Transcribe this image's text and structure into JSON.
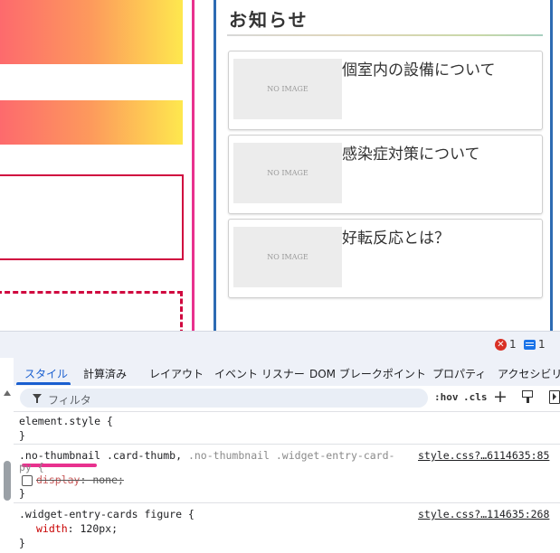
{
  "preview": {
    "widget_title": "お知らせ",
    "cards": [
      {
        "thumb": "NO IMAGE",
        "title": "個室内の設備について"
      },
      {
        "thumb": "NO IMAGE",
        "title": "感染症対策について"
      },
      {
        "thumb": "NO IMAGE",
        "title": "好転反応とは？"
      }
    ]
  },
  "devtools": {
    "error_count": "1",
    "message_count": "1",
    "tabs": [
      "スタイル",
      "計算済み",
      "レイアウト",
      "イベント リスナー",
      "DOM ブレークポイント",
      "プロパティ",
      "アクセシビリティ"
    ],
    "filter_placeholder": "フィルタ",
    "hov": ":hov",
    "cls": ".cls",
    "plus": "+",
    "rules": {
      "element_style": "element.style {",
      "close": "}",
      "rule1_sel_a": ".no-thumbnail",
      "rule1_sel_b": " .card-thumb, ",
      "rule1_sel_c": ".no-thumbnail .widget-entry-card-",
      "rule1_sel_d": "py {",
      "rule1_source": "style.css?…6114635:85",
      "rule1_prop": "display",
      "rule1_val": ": none;",
      "rule2_sel": ".widget-entry-cards figure {",
      "rule2_source": "style.css?…114635:268",
      "rule2_prop": "width",
      "rule2_val": ": 120px;"
    }
  },
  "colors": {
    "accent_blue": "#1a5fd0",
    "sidebar_border": "#2d6bb3",
    "pink": "#e8318e",
    "crimson": "#d0083f"
  }
}
